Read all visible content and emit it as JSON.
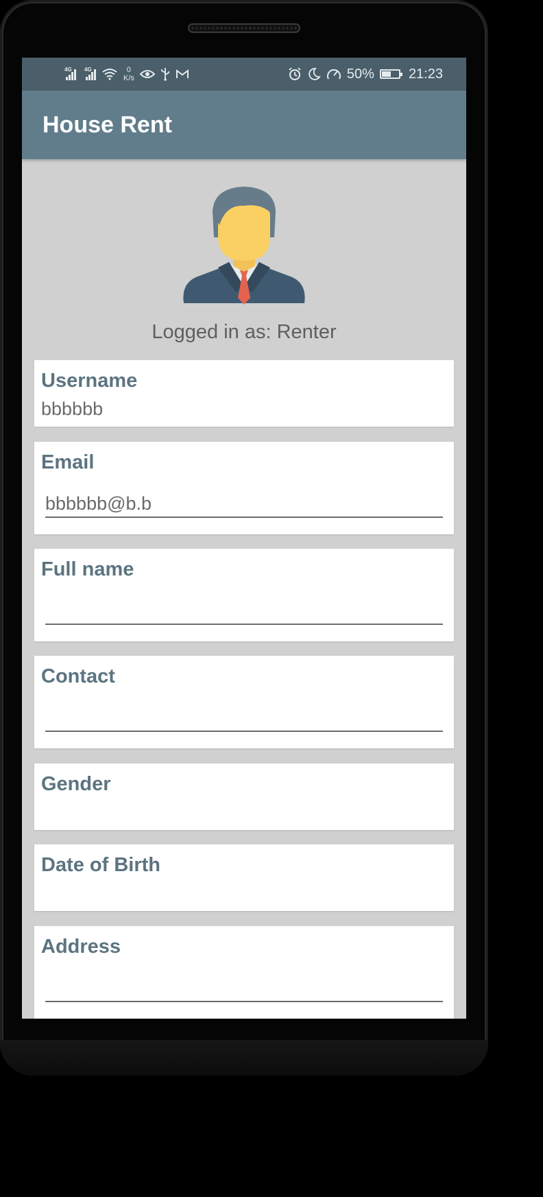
{
  "status_bar": {
    "network_speed_value": "0",
    "network_speed_unit": "K/s",
    "battery_percent": "50%",
    "time": "21:23",
    "signal_tag_1": "4G",
    "signal_tag_2": "4G"
  },
  "app_bar": {
    "title": "House Rent"
  },
  "profile": {
    "role_text": "Logged in as: Renter",
    "avatar_icon": "businessman-avatar-icon"
  },
  "fields": {
    "username": {
      "label": "Username",
      "value": "bbbbbb"
    },
    "email": {
      "label": "Email",
      "value": "bbbbbb@b.b"
    },
    "full_name": {
      "label": "Full name",
      "value": ""
    },
    "contact": {
      "label": "Contact",
      "value": ""
    },
    "gender": {
      "label": "Gender",
      "value": ""
    },
    "dob": {
      "label": "Date of Birth",
      "value": ""
    },
    "address": {
      "label": "Address",
      "value": ""
    }
  },
  "colors": {
    "status_bar": "#4a5f6a",
    "app_bar": "#617d8b",
    "screen_bg": "#cfd0cf",
    "label": "#5c7480"
  }
}
